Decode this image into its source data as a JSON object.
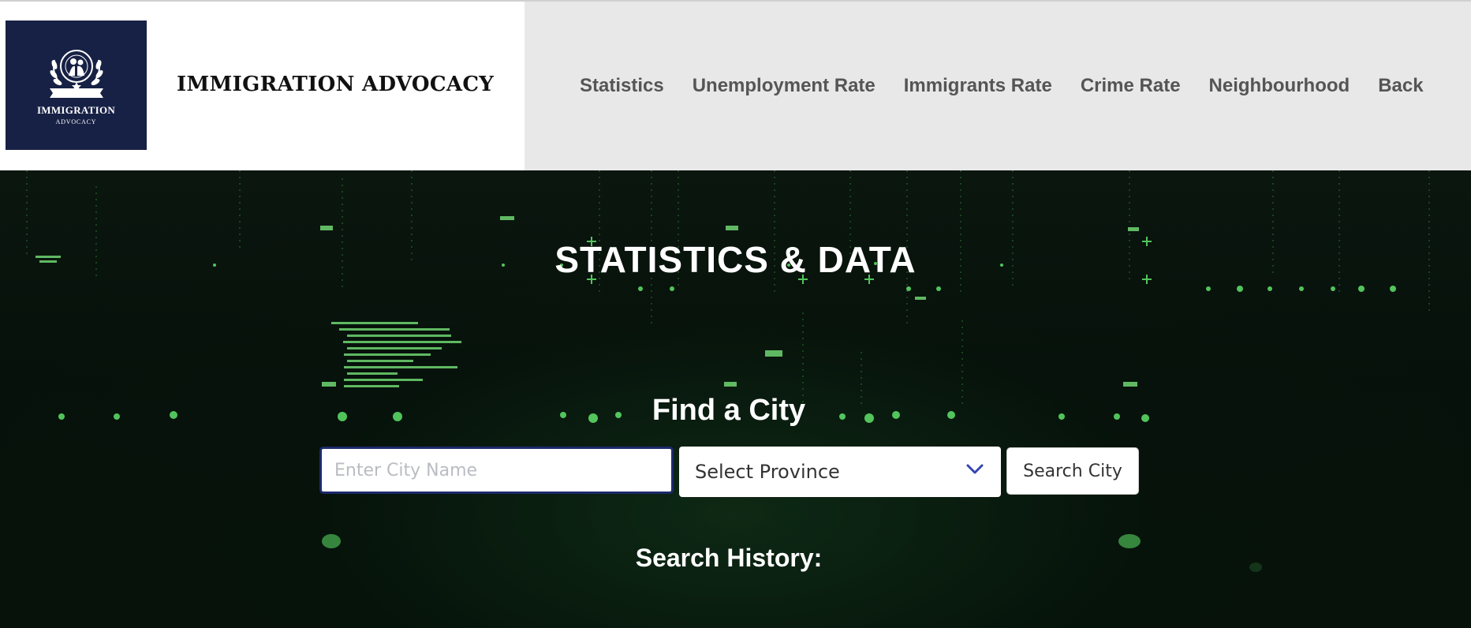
{
  "brand": {
    "logo_title": "IMMIGRATION",
    "logo_sub": "ADVOCACY",
    "site_title": "IMMIGRATION ADVOCACY"
  },
  "nav": {
    "items": [
      {
        "label": "Statistics"
      },
      {
        "label": "Unemployment Rate"
      },
      {
        "label": "Immigrants Rate"
      },
      {
        "label": "Crime Rate"
      },
      {
        "label": "Neighbourhood"
      },
      {
        "label": "Back"
      }
    ]
  },
  "hero": {
    "title": "STATISTICS & DATA",
    "find_title": "Find a City",
    "history_title": "Search History:"
  },
  "search": {
    "city_placeholder": "Enter City Name",
    "city_value": "",
    "province_selected": "Select Province",
    "button_label": "Search City"
  },
  "colors": {
    "logo_bg": "#172145",
    "header_bg": "#e9e8e9",
    "hero_accent": "#5fe36a",
    "input_border": "#1c2a6b"
  }
}
